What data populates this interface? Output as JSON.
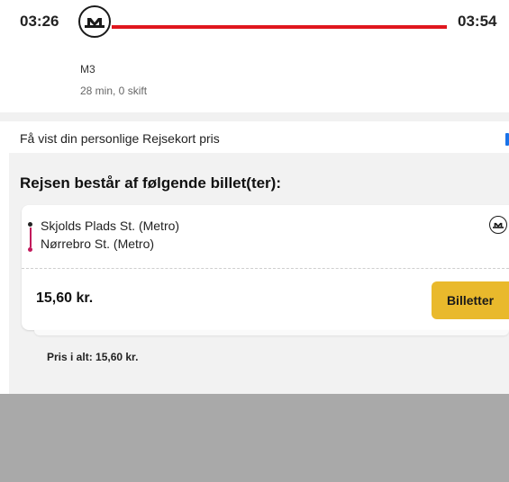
{
  "trip": {
    "departure_time": "03:26",
    "arrival_time": "03:54",
    "line_name": "M3",
    "duration_text": "28 min, 0 skift",
    "line_color": "#e0161e",
    "mode_icon": "metro-icon"
  },
  "personal_price": {
    "label": "Få vist din personlige Rejsekort pris",
    "toggle_color": "#1a73e8"
  },
  "tickets": {
    "title": "Rejsen består af følgende billet(ter):",
    "items": [
      {
        "from": "Skjolds Plads St. (Metro)",
        "to": "Nørrebro St. (Metro)",
        "mode_icon": "metro-icon",
        "price": "15,60 kr.",
        "button_label": "Billetter",
        "button_color": "#e9b92c"
      }
    ],
    "total": "Pris i alt: 15,60 kr."
  }
}
